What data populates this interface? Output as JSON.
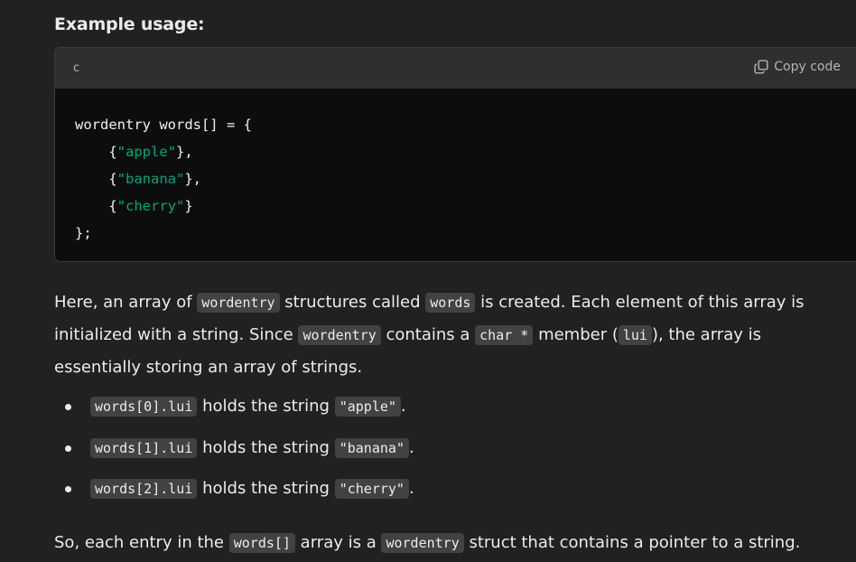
{
  "heading": "Example usage:",
  "code_block": {
    "language": "c",
    "copy_label": "Copy code",
    "icon": "copy-icon",
    "lines": [
      {
        "pre": "wordentry words[] = {",
        "str": "",
        "post": ""
      },
      {
        "pre": "    {",
        "str": "\"apple\"",
        "post": "},"
      },
      {
        "pre": "    {",
        "str": "\"banana\"",
        "post": "},"
      },
      {
        "pre": "    {",
        "str": "\"cherry\"",
        "post": "}"
      },
      {
        "pre": "};",
        "str": "",
        "post": ""
      }
    ]
  },
  "paragraph1": {
    "t1": "Here, an array of ",
    "c1": "wordentry",
    "t2": " structures called ",
    "c2": "words",
    "t3": " is created. Each element of this array is initialized with a string. Since ",
    "c3": "wordentry",
    "t4": " contains a ",
    "c4": "char *",
    "t5": " member (",
    "c5": "lui",
    "t6": "), the array is essentially storing an array of strings."
  },
  "bullets": [
    {
      "code": "words[0].lui",
      "text": " holds the string ",
      "value": "\"apple\"",
      "end": "."
    },
    {
      "code": "words[1].lui",
      "text": " holds the string ",
      "value": "\"banana\"",
      "end": "."
    },
    {
      "code": "words[2].lui",
      "text": " holds the string ",
      "value": "\"cherry\"",
      "end": "."
    }
  ],
  "paragraph2": {
    "t1": "So, each entry in the ",
    "c1": "words[]",
    "t2": " array is a ",
    "c2": "wordentry",
    "t3": " struct that contains a pointer to a string."
  },
  "colors": {
    "background": "#212121",
    "code_background": "#0d0d0d",
    "code_header": "#2f2f2f",
    "string_literal": "#00a67d",
    "inline_code_bg": "#424242"
  }
}
